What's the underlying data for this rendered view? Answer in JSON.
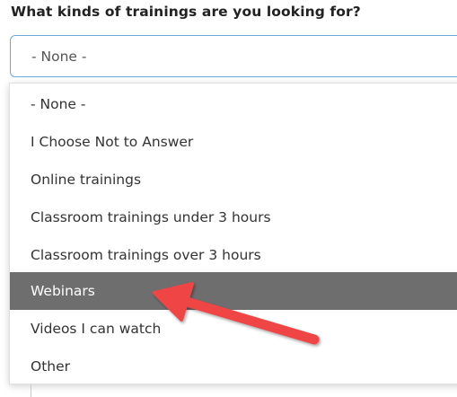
{
  "form": {
    "question": "What kinds of trainings are you looking for?",
    "select": {
      "selected_value": "- None -"
    },
    "options": [
      {
        "label": "- None -"
      },
      {
        "label": "I Choose Not to Answer"
      },
      {
        "label": "Online trainings"
      },
      {
        "label": "Classroom trainings under 3 hours"
      },
      {
        "label": "Classroom trainings over 3 hours"
      },
      {
        "label": "Webinars",
        "highlighted": true
      },
      {
        "label": "Videos I can watch"
      },
      {
        "label": "Other"
      }
    ]
  },
  "annotation": {
    "icon": "red-arrow-icon",
    "color": "#ef4444"
  },
  "colors": {
    "highlight": "#6e6e6e",
    "select_border": "#6ea8d9"
  }
}
